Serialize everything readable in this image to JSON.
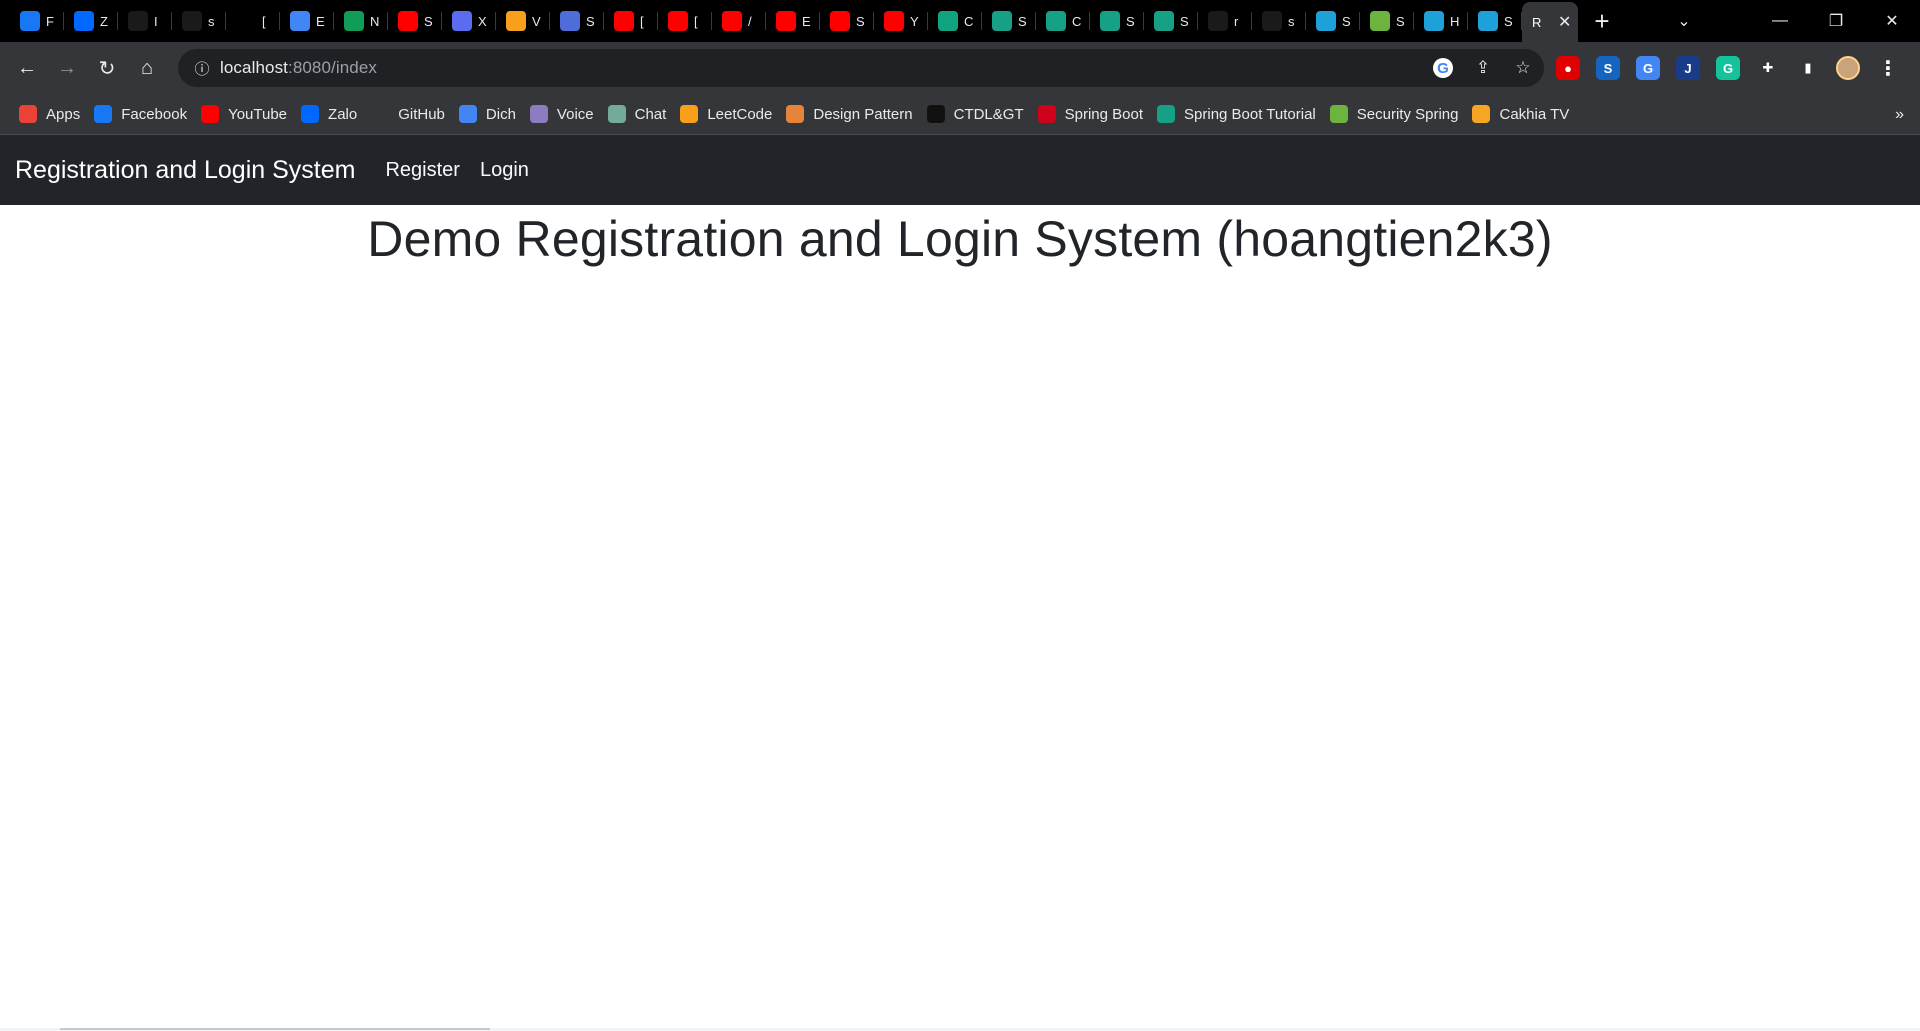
{
  "browser": {
    "tabs": [
      {
        "letter": "F",
        "icon": "facebook-icon",
        "color": "#1877f2"
      },
      {
        "letter": "Z",
        "icon": "zalo-icon",
        "color": "#0068ff"
      },
      {
        "letter": "I",
        "icon": "github-icon",
        "color": "#1a1a1a"
      },
      {
        "letter": "s",
        "icon": "github-icon",
        "color": "#1a1a1a"
      },
      {
        "letter": "[",
        "icon": "chatgpt-icon",
        "color": "#000000"
      },
      {
        "letter": "E",
        "icon": "google-docs-icon",
        "color": "#4285f4"
      },
      {
        "letter": "N",
        "icon": "google-sheets-icon",
        "color": "#0f9d58"
      },
      {
        "letter": "S",
        "icon": "youtube-icon",
        "color": "#ff0000"
      },
      {
        "letter": "X",
        "icon": "extension-icon",
        "color": "#5b6cf0"
      },
      {
        "letter": "V",
        "icon": "leetcode-icon",
        "color": "#f89f1b"
      },
      {
        "letter": "S",
        "icon": "vuejs-icon",
        "color": "#4f6dd8"
      },
      {
        "letter": "[",
        "icon": "youtube-icon",
        "color": "#ff0000"
      },
      {
        "letter": "[",
        "icon": "youtube-icon",
        "color": "#ff0000"
      },
      {
        "letter": "/",
        "icon": "youtube-icon",
        "color": "#ff0000"
      },
      {
        "letter": "E",
        "icon": "youtube-icon",
        "color": "#ff0000"
      },
      {
        "letter": "S",
        "icon": "youtube-icon",
        "color": "#ff0000"
      },
      {
        "letter": "Y",
        "icon": "youtube-icon",
        "color": "#ff0000"
      },
      {
        "letter": "C",
        "icon": "chatgpt-icon",
        "color": "#10a37f"
      },
      {
        "letter": "S",
        "icon": "javascript-icon",
        "color": "#16a085"
      },
      {
        "letter": "C",
        "icon": "javascript-icon",
        "color": "#16a085"
      },
      {
        "letter": "S",
        "icon": "javascript-icon",
        "color": "#16a085"
      },
      {
        "letter": "S",
        "icon": "javascript-icon",
        "color": "#16a085"
      },
      {
        "letter": "r",
        "icon": "github-icon",
        "color": "#1a1a1a"
      },
      {
        "letter": "s",
        "icon": "github-icon",
        "color": "#1a1a1a"
      },
      {
        "letter": "S",
        "icon": "toptal-icon",
        "color": "#1ea0d8"
      },
      {
        "letter": "S",
        "icon": "spring-icon",
        "color": "#6db33f"
      },
      {
        "letter": "H",
        "icon": "toptal-icon",
        "color": "#1ea0d8"
      },
      {
        "letter": "S",
        "icon": "toptal-icon",
        "color": "#1ea0d8"
      }
    ],
    "active_tab": {
      "letter": "R",
      "close": "✕"
    },
    "new_tab": "+",
    "window_controls": {
      "tab_search": "⌄",
      "minimize": "—",
      "restore": "❐",
      "close": "✕"
    },
    "url": {
      "host": "localhost",
      "path": ":8080/index"
    },
    "nav": {
      "back": "←",
      "forward": "→",
      "reload": "↻",
      "home": "⌂"
    }
  },
  "extensions": [
    {
      "icon": "adblock-icon",
      "color": "#e00000",
      "glyph": "●"
    },
    {
      "icon": "spring-s-icon",
      "color": "#1565c0",
      "glyph": "S"
    },
    {
      "icon": "google-translate-icon",
      "color": "#4285f4",
      "glyph": "G"
    },
    {
      "icon": "j-extension-icon",
      "color": "#1a3a8a",
      "glyph": "J"
    },
    {
      "icon": "grammarly-icon",
      "color": "#15c39a",
      "glyph": "G"
    },
    {
      "icon": "puzzle-icon",
      "color": "#35363a",
      "glyph": "✚"
    },
    {
      "icon": "side-panel-icon",
      "color": "#35363a",
      "glyph": "▮"
    },
    {
      "icon": "avatar",
      "color": "#c9a37a",
      "glyph": ""
    },
    {
      "icon": "kebab-menu-icon",
      "color": "#35363a",
      "glyph": "⋮"
    }
  ],
  "bookmarks": [
    {
      "label": "Apps",
      "icon": "apps-grid-icon",
      "color": "#ea4335"
    },
    {
      "label": "Facebook",
      "icon": "facebook-icon",
      "color": "#1877f2"
    },
    {
      "label": "YouTube",
      "icon": "youtube-icon",
      "color": "#ff0000"
    },
    {
      "label": "Zalo",
      "icon": "zalo-icon",
      "color": "#0068ff"
    },
    {
      "label": "GitHub",
      "icon": "github-icon",
      "color": "#35363a"
    },
    {
      "label": "Dich",
      "icon": "google-translate-icon",
      "color": "#4285f4"
    },
    {
      "label": "Voice",
      "icon": "microphone-icon",
      "color": "#8e7cc3"
    },
    {
      "label": "Chat",
      "icon": "chatgpt-icon",
      "color": "#74aa9c"
    },
    {
      "label": "LeetCode",
      "icon": "leetcode-icon",
      "color": "#f89f1b"
    },
    {
      "label": "Design Pattern",
      "icon": "refactoring-guru-icon",
      "color": "#e8833a"
    },
    {
      "label": "CTDL&GT",
      "icon": "visualgo-icon",
      "color": "#111111"
    },
    {
      "label": "Spring Boot",
      "icon": "tutorial-icon",
      "color": "#d0021b"
    },
    {
      "label": "Spring Boot Tutorial",
      "icon": "javascript-icon",
      "color": "#16a085"
    },
    {
      "label": "Security Spring",
      "icon": "spring-icon",
      "color": "#6db33f"
    },
    {
      "label": "Cakhia TV",
      "icon": "cakhia-icon",
      "color": "#f5a623"
    }
  ],
  "bookmarks_more": "»",
  "page": {
    "brand": "Registration and Login System",
    "nav_links": [
      "Register",
      "Login"
    ],
    "heading": "Demo Registration and Login System (hoangtien2k3)"
  }
}
